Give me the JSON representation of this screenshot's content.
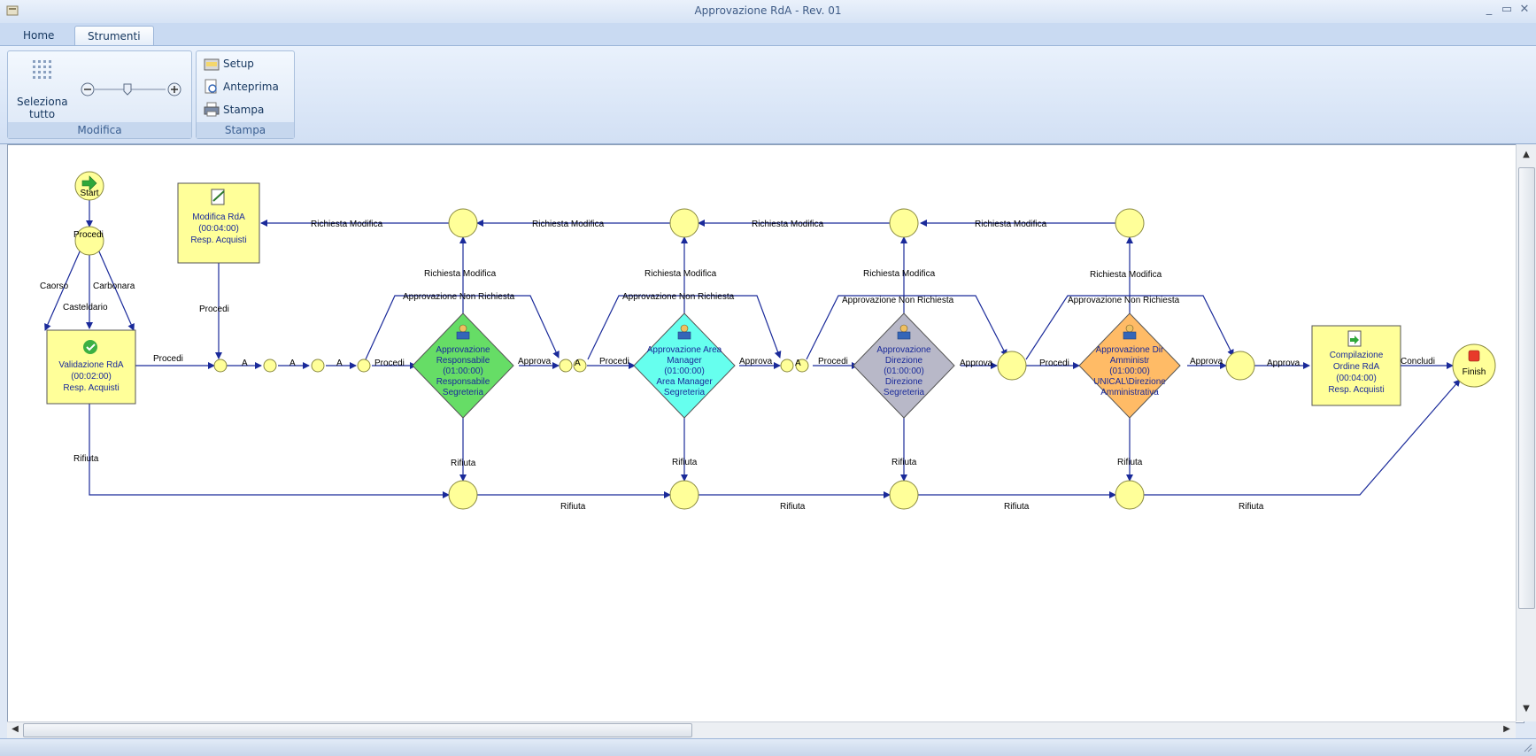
{
  "window": {
    "title": "Approvazione RdA - Rev. 01",
    "controls": [
      "minimize",
      "maximize",
      "close"
    ]
  },
  "tabs": [
    {
      "label": "Home",
      "active": false
    },
    {
      "label": "Strumenti",
      "active": true
    }
  ],
  "ribbon": {
    "modifica": {
      "group_label": "Modifica",
      "select_all_line1": "Seleziona",
      "select_all_line2": "tutto"
    },
    "stampa": {
      "group_label": "Stampa",
      "setup": "Setup",
      "preview": "Anteprima",
      "print": "Stampa"
    }
  },
  "diagram": {
    "start": "Start",
    "finish": "Finish",
    "validazione": [
      "Validazione RdA",
      "(00:02:00)",
      "Resp. Acquisti"
    ],
    "modifica_rda": [
      "Modifica RdA",
      "(00:04:00)",
      "Resp. Acquisti"
    ],
    "compilazione": [
      "Compilazione",
      "Ordine RdA",
      "(00:04:00)",
      "Resp. Acquisti"
    ],
    "approvazione_responsabile": [
      "Approvazione",
      "Responsabile",
      "(01:00:00)",
      "Responsabile",
      "Segreteria"
    ],
    "approvazione_area_manager": [
      "Approvazione Area",
      "Manager",
      "(01:00:00)",
      "Area Manager",
      "Segreteria"
    ],
    "approvazione_direzione": [
      "Approvazione",
      "Direzione",
      "(01:00:00)",
      "Direzione",
      "Segreteria"
    ],
    "approvazione_dir_amministr": [
      "Approvazione Dir",
      "Amministr",
      "(01:00:00)",
      "UNICAL\\Direzione",
      "Amministrativa"
    ],
    "labels": {
      "procedi": "Procedi",
      "caorso": "Caorso",
      "carbonara": "Carbonara",
      "casteldario": "Casteldario",
      "rifiuta": "Rifiuta",
      "richiesta_modifica": "Richiesta Modifica",
      "approvazione_non_richiesta": "Approvazione Non Richiesta",
      "approva": "Approva",
      "concludi": "Concludi",
      "a": "A"
    },
    "colors": {
      "process_box": "#ffff99",
      "connector": "#ffff99",
      "approvazione_responsabile": "#66dd66",
      "approvazione_area_manager": "#66ffee",
      "approvazione_direzione": "#b8b8c8",
      "approvazione_dir_amministr": "#ffbb66",
      "edge": "#1a2a9a"
    }
  }
}
